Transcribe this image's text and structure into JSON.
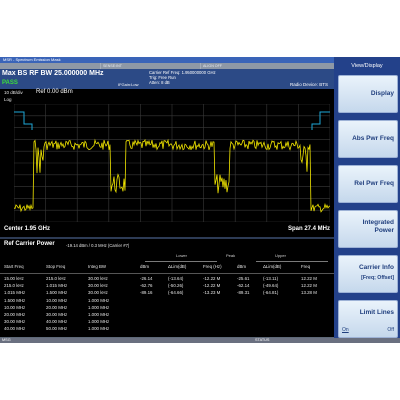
{
  "window": {
    "title": "MSR - Spectrum Emission Mask"
  },
  "status_strip": {
    "sense": "SENSE:INT",
    "align": "ALIGN OFF"
  },
  "header": {
    "title": "Max BS RF BW 25.000000 MHz",
    "verdict": "PASS",
    "carrier_ref_freq": "Carrier Ref Freq: 1.950000000 GHz",
    "trig": "Trig: Free Run",
    "atten": "Atten: 8 dB",
    "if_gain": "IFGain:Low",
    "radio_device": "Radio Device: BTS"
  },
  "trace": {
    "div": "10 dB/div",
    "ref": "Ref 0.00 dBm",
    "scale": "Log",
    "center": "Center 1.95 GHz",
    "span": "Span 27.4 MHz",
    "colors": {
      "trace": "#f2e600",
      "mask": "#1ea7d8",
      "grid": "#3a3a3a"
    }
  },
  "results": {
    "title": "Ref Carrier Power",
    "info": "-19.14 dBm /    0.3 MHz    (Carrier #7)",
    "groups": {
      "lower": "Lower",
      "peak": "Peak",
      "upper": "Upper"
    },
    "columns": [
      "Start Freq",
      "Stop Freq",
      "Integ BW",
      "dBm",
      "ΔLim(dB)",
      "Freq (Hz)",
      "dBm",
      "ΔLim(dB)",
      "Freq"
    ],
    "rows": [
      [
        "15.00 kHz",
        "215.0 kHz",
        "30.00 kHz",
        "-26.14",
        "(-13.64)",
        "-12.22 M",
        "-25.61",
        "(-13.11)",
        "12.22 M"
      ],
      [
        "215.0 kHz",
        "1.015 MHz",
        "30.00 kHz",
        "-62.76",
        "(-50.26)",
        "-12.22 M",
        "-62.14",
        "(-49.64)",
        "12.22 M"
      ],
      [
        "1.015 MHz",
        "1.500 MHz",
        "30.00 kHz",
        "-89.16",
        "(-64.66)",
        "-13.23 M",
        "-89.31",
        "(-64.81)",
        "13.28 M"
      ],
      [
        "1.500 MHz",
        "10.00 MHz",
        "1.000 MHz",
        "",
        "",
        "",
        "",
        "",
        ""
      ],
      [
        "10.00 MHz",
        "20.00 MHz",
        "1.000 MHz",
        "",
        "",
        "",
        "",
        "",
        ""
      ],
      [
        "20.00 MHz",
        "30.00 MHz",
        "1.000 MHz",
        "",
        "",
        "",
        "",
        "",
        ""
      ],
      [
        "30.00 MHz",
        "40.00 MHz",
        "1.000 MHz",
        "",
        "",
        "",
        "",
        "",
        ""
      ],
      [
        "40.00 MHz",
        "50.00 MHz",
        "1.000 MHz",
        "",
        "",
        "",
        "",
        "",
        ""
      ]
    ]
  },
  "softkeys": {
    "title": "View/Display",
    "items": [
      {
        "label": "Display",
        "sub": "",
        "icon": "triangle-right-icon"
      },
      {
        "label": "Abs Pwr Freq",
        "sub": ""
      },
      {
        "label": "Rel Pwr Freq",
        "sub": ""
      },
      {
        "label": "Integrated Power",
        "sub": ""
      },
      {
        "label": "Carrier Info",
        "sub": "[Freq; Offset]",
        "icon": "triangle-right-icon"
      },
      {
        "label": "Limit Lines",
        "on": "On",
        "off": "Off"
      }
    ]
  },
  "msg_bar": {
    "msg": "MSG",
    "status": "STATUS"
  }
}
